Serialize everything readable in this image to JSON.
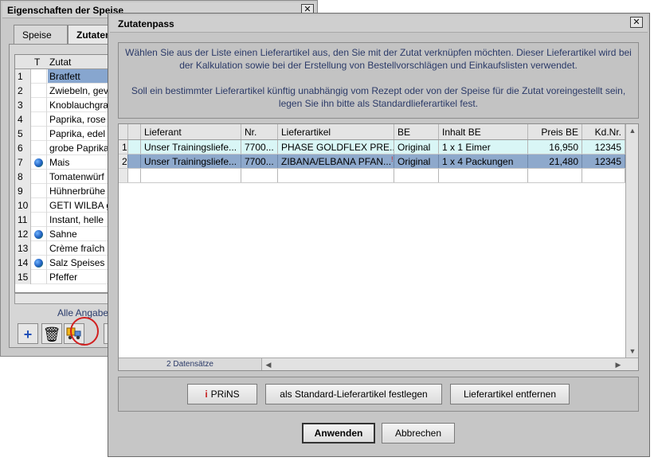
{
  "back_window": {
    "title": "Eigenschaften der Speise",
    "close": "✕",
    "tabs": [
      "Speise",
      "Zutaten"
    ],
    "columns": {
      "t": "T",
      "zutat": "Zutat"
    },
    "rows": [
      {
        "num": "1",
        "name": "Bratfett",
        "globe": false,
        "selected": true
      },
      {
        "num": "2",
        "name": "Zwiebeln, gev",
        "globe": false
      },
      {
        "num": "3",
        "name": "Knoblauchgra",
        "globe": false
      },
      {
        "num": "4",
        "name": "Paprika, rose",
        "globe": false
      },
      {
        "num": "5",
        "name": "Paprika, edel",
        "globe": false
      },
      {
        "num": "6",
        "name": "grobe Paprika",
        "globe": false
      },
      {
        "num": "7",
        "name": "Mais",
        "globe": true
      },
      {
        "num": "8",
        "name": "Tomatenwürf",
        "globe": false
      },
      {
        "num": "9",
        "name": "Hühnerbrühe",
        "globe": false
      },
      {
        "num": "10",
        "name": "GETI WILBA g",
        "globe": false
      },
      {
        "num": "11",
        "name": "Instant, helle",
        "globe": false
      },
      {
        "num": "12",
        "name": "Sahne",
        "globe": true
      },
      {
        "num": "13",
        "name": "Crème fraîch",
        "globe": false
      },
      {
        "num": "14",
        "name": "Salz Speises",
        "globe": true
      },
      {
        "num": "15",
        "name": "Pfeffer",
        "globe": false
      }
    ],
    "note": "Alle Angabe",
    "tool_icons": [
      "plus-icon",
      "trash-icon",
      "supplier-truck-icon"
    ]
  },
  "dialog": {
    "title": "Zutatenpass",
    "close": "✕",
    "info_line1": "Wählen Sie aus der Liste einen Lieferartikel aus, den Sie mit der Zutat verknüpfen möchten. Dieser Lieferartikel wird bei der Kalkulation sowie bei der Erstellung von Bestellvorschlägen und Einkaufslisten verwendet.",
    "info_line2": "Soll ein bestimmter Lieferartikel künftig unabhängig vom Rezept oder von der Speise für die Zutat voreingestellt sein, legen Sie ihn bitte als Standardlieferartikel fest.",
    "columns": {
      "lieferant": "Lieferant",
      "nr": "Nr.",
      "lieferartikel": "Lieferartikel",
      "be": "BE",
      "inhalt": "Inhalt BE",
      "preis": "Preis BE",
      "kdnr": "Kd.Nr."
    },
    "rows": [
      {
        "num": "1",
        "lieferant": "Unser Trainingsliefe...",
        "nr": "7700...",
        "artikel": "PHASE GOLDFLEX PRE...",
        "warn": "",
        "be": "Original",
        "inhalt": "1 x 1 Eimer",
        "preis": "16,950",
        "kdnr": "12345"
      },
      {
        "num": "2",
        "lieferant": "Unser Trainingsliefe...",
        "nr": "7700...",
        "artikel": "ZIBANA/ELBANA PFAN...",
        "warn": "!",
        "be": "Original",
        "inhalt": "1 x 4 Packungen",
        "preis": "21,480",
        "kdnr": "12345"
      }
    ],
    "status": "2 Datensätze",
    "buttons": {
      "prins_mark": "i",
      "prins": "PRiNS",
      "standard": "als Standard-Lieferartikel festlegen",
      "remove": "Lieferartikel entfernen",
      "apply": "Anwenden",
      "cancel": "Abbrechen"
    }
  }
}
